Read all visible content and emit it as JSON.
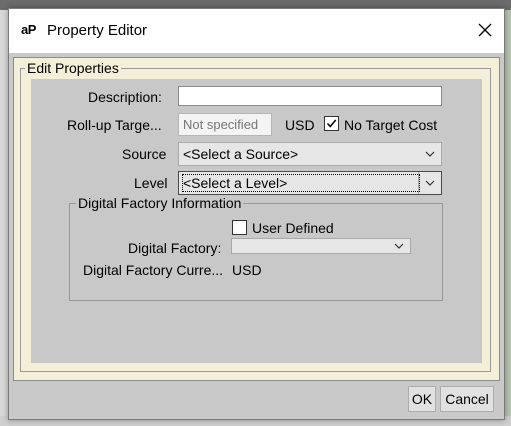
{
  "window": {
    "app_icon_text": "aP",
    "title": "Property Editor"
  },
  "group": {
    "legend": "Edit Properties"
  },
  "form": {
    "description_label": "Description:",
    "description_value": "",
    "rollup_label": "Roll-up Targe...",
    "rollup_placeholder": "Not specified",
    "currency_label": "USD",
    "no_target_cost_label": "No Target Cost",
    "no_target_cost_checked": true,
    "source_label": "Source",
    "source_value": "<Select a Source>",
    "level_label": "Level",
    "level_value": "<Select a Level>"
  },
  "digital_factory": {
    "legend": "Digital Factory Information",
    "user_defined_label": "User Defined",
    "user_defined_checked": false,
    "factory_label": "Digital Factory:",
    "factory_value": "",
    "currency_label": "Digital Factory Curre...",
    "currency_value": "USD"
  },
  "buttons": {
    "ok": "OK",
    "cancel": "Cancel"
  },
  "icons": {
    "close": "close-icon",
    "chevron": "chevron-down-icon",
    "check": "check-icon"
  }
}
